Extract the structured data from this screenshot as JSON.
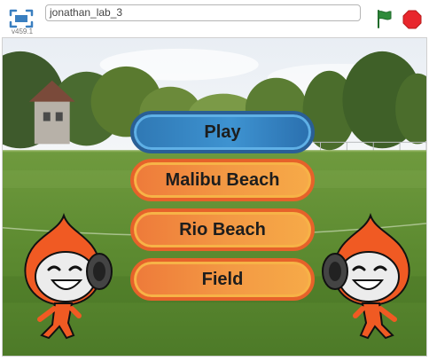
{
  "header": {
    "version": "v459.1",
    "project_title": "jonathan_lab_3"
  },
  "icons": {
    "fullscreen": "fullscreen-icon",
    "green_flag": "green-flag-icon",
    "stop": "stop-sign-icon"
  },
  "stage": {
    "buttons": {
      "play": "Play",
      "malibu": "Malibu Beach",
      "rio": "Rio Beach",
      "field": "Field"
    },
    "sprites": [
      "pico-sprite-left",
      "pico-sprite-right"
    ]
  },
  "colors": {
    "play_button": "#3e93d1",
    "scene_button": "#f39a44",
    "flag": "#2e8b3a",
    "stop": "#e8262c",
    "sprite_orange": "#f05a23"
  }
}
